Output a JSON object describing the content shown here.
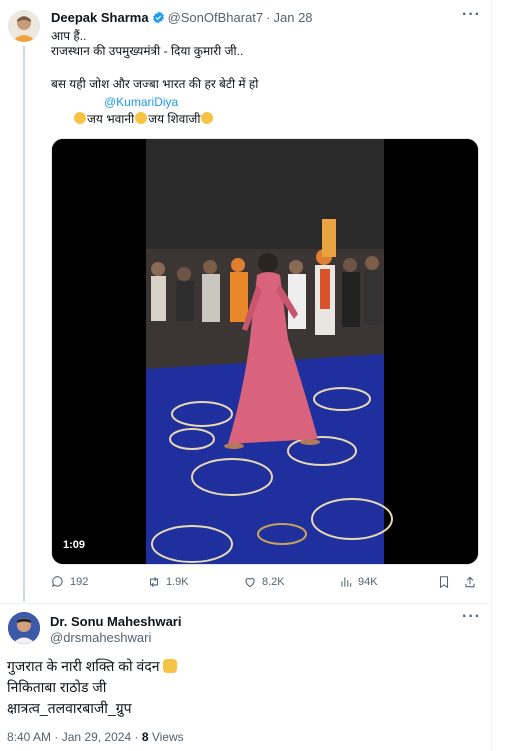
{
  "tweet": {
    "author_name": "Deepak Sharma",
    "handle": "@SonOfBharat7",
    "separator": "·",
    "date": "Jan 28",
    "lines": [
      "आप हैं..",
      "राजस्थान की उपमुख्यमंत्री - दिया कुमारी जी..",
      "बस यही जोश और जज्बा भारत की हर बेटी में हो"
    ],
    "mention": "@KumariDiya",
    "chant_1": "जय भवानी",
    "chant_2": "जय शिवाजी",
    "video_duration": "1:09",
    "stats": {
      "replies": "192",
      "reposts": "1.9K",
      "likes": "8.2K",
      "views": "94K"
    },
    "more_icon": "ellipsis-icon"
  },
  "reply": {
    "author_name": "Dr. Sonu Maheshwari",
    "handle": "@drsmaheshwari",
    "line1": "गुजरात के नारी शक्ति को वंदन",
    "line2": "निकिताबा राठोड जी",
    "line3": "क्षात्रत्व_तलवारबाजी_ग्रुप",
    "time": "8:40 AM",
    "separator": "·",
    "date": "Jan 29, 2024",
    "views_count": "8",
    "views_label": "Views"
  },
  "colors": {
    "accent": "#1d9bf0",
    "secondary_text": "#536471",
    "carpet": "#1f2f9e",
    "dress": "#d9637c"
  }
}
